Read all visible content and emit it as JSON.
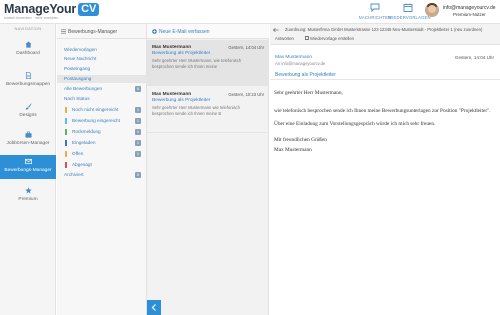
{
  "brand": {
    "name": "ManageYour",
    "badge": "CV",
    "tagline": "einfach bewerben · mehr erreichen",
    "accent": "#2d8fd6"
  },
  "header": {
    "messages_label": "NACHRICHTEN",
    "templates_label": "WIEDERVORLAGEN",
    "user_email": "info@manageyourcv.de",
    "user_plan": "Premium-Nutzer"
  },
  "sidebar": {
    "heading": "NAVIGATION",
    "items": [
      {
        "label": "Dashboard",
        "icon": "home-icon"
      },
      {
        "label": "Bewerbungsmappen",
        "icon": "file-icon"
      },
      {
        "label": "Designs",
        "icon": "brush-icon"
      },
      {
        "label": "Jobbörsen-Manager",
        "icon": "briefcase-icon"
      },
      {
        "label": "Bewerbungs-Manager",
        "icon": "envelope-icon"
      },
      {
        "label": "Premium",
        "icon": "star-icon"
      }
    ]
  },
  "folders": {
    "title": "Bewerbungs-Manager",
    "items": [
      {
        "label": "Wiedervorlagen"
      },
      {
        "label": "Neue Nachricht"
      },
      {
        "label": "Posteingang"
      },
      {
        "label": "Postausgang"
      },
      {
        "label": "Alle Bewerbungen",
        "count": "5"
      },
      {
        "label": "Nach Status"
      },
      {
        "label": "Noch nicht eingereicht",
        "count": "1",
        "color": "#f0ad4e"
      },
      {
        "label": "Bewerbung eingereicht",
        "count": "1",
        "color": "#5bc0de"
      },
      {
        "label": "Rückmeldung",
        "count": "1",
        "color": "#5cb85c"
      },
      {
        "label": "Eingeladen",
        "count": "1",
        "color": "#337ab7"
      },
      {
        "label": "Offen",
        "count": "1",
        "color": "#f0ad4e"
      },
      {
        "label": "Abgesagt",
        "color": "#d9534f"
      },
      {
        "label": "Archiviert",
        "count": "0"
      }
    ]
  },
  "messages": {
    "compose_label": "Neue E-Mail verfassen",
    "items": [
      {
        "from": "Max Mustermann",
        "date": "Gestern, 14:04 Uhr",
        "subject": "Bewerbung als Projektleiter",
        "preview": "Sehr geehrter Herr Mustermann, wie telefonisch besprochen sende ich Ihnen meine"
      },
      {
        "from": "Max Mustermann",
        "date": "Gestern, 10:23 Uhr",
        "subject": "Bewerbung als Projektleiter",
        "preview": "Sehr geehrter Herr Mustermann wie telefonisch besprochen sende ich Ihnen meine B"
      }
    ]
  },
  "reader": {
    "reply_text": "Zuordnung: Musterfirma GmbH Musterstrasse 123 12345 Neu-Musterstadt - Projektleiter 1 (neu zuordnen)",
    "action_reply": "Antworten",
    "action_template": "Wiedervorlage erstellen",
    "from": "Max Mustermann",
    "email": "An info@manageyourcv.de",
    "date": "Gestern, 14:04 Uhr",
    "subject": "Bewerbung als Projektleiter",
    "body": [
      "Sehr geehrter Herr Mustermann,",
      "wie telefonisch besprochen sende ich Ihnen meine Bewerbungsunterlagen zur Position \"Projektleiter\".",
      "Über eine Einladung zum Vorstellungsgespräch würde ich mich sehr freuen.",
      "Mit freundlichen Grüßen",
      "Max Mustermann"
    ]
  }
}
